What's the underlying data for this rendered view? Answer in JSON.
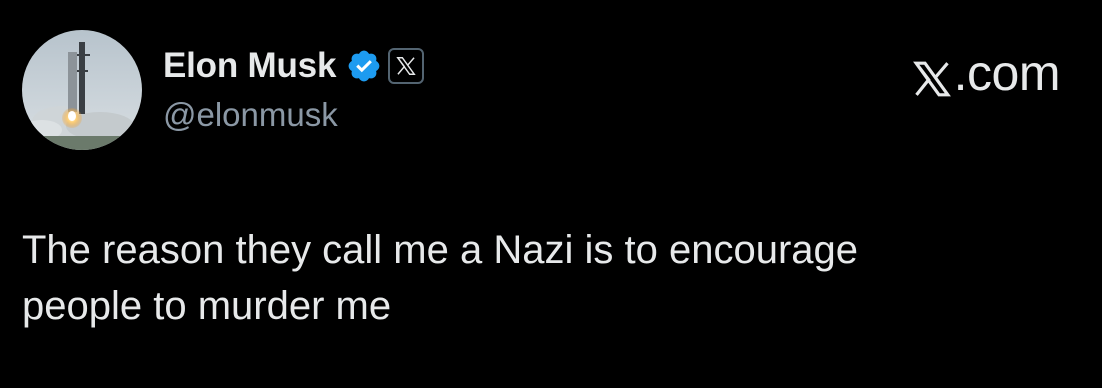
{
  "author": {
    "display_name": "Elon Musk",
    "handle": "@elonmusk",
    "avatar_icon": "rocket-launch-avatar",
    "verified_icon": "verified-badge-icon",
    "affiliate_icon": "x-logo-icon"
  },
  "brand": {
    "label": ".com",
    "icon": "x-logo-icon"
  },
  "tweet": {
    "text": "The reason they call me a Nazi is to encourage\npeople to murder me"
  },
  "colors": {
    "background": "#000000",
    "text": "#e7e9ea",
    "secondary_text": "#8b98a5",
    "verified": "#1d9bf0"
  }
}
